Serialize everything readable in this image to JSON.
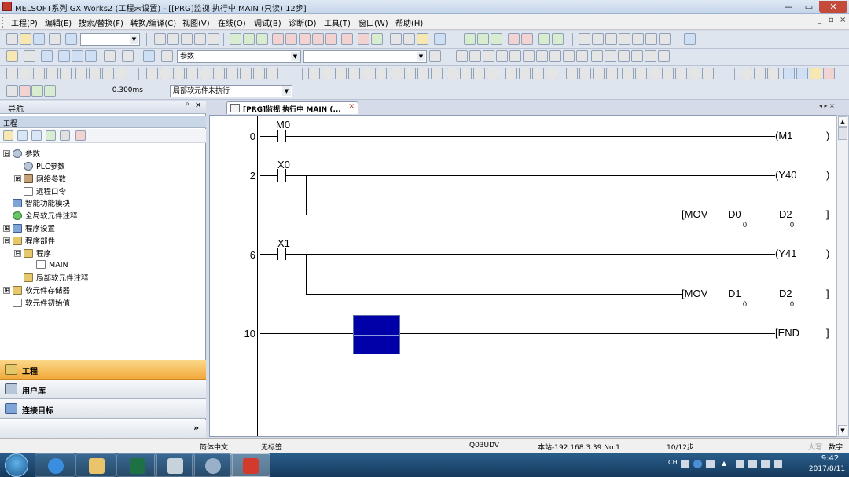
{
  "window": {
    "title": "MELSOFT系列 GX Works2 (工程未设置) - [[PRG]监视 执行中 MAIN (只读) 12步]",
    "min_glyph": "—",
    "max_glyph": "▭",
    "close_glyph": "✕"
  },
  "menu": {
    "items": [
      "工程(P)",
      "编辑(E)",
      "搜索/替换(F)",
      "转换/编译(C)",
      "视图(V)",
      "在线(O)",
      "调试(B)",
      "诊断(D)",
      "工具(T)",
      "窗口(W)",
      "帮助(H)"
    ],
    "child_min": "_",
    "child_restore": "▫",
    "child_close": "×"
  },
  "toolbar": {
    "device_combo": "参数",
    "monitor_interval": "0.300ms",
    "local_device_status": "局部软元件未执行"
  },
  "nav": {
    "title": "导航",
    "pin": "ᵖ",
    "close": "✕",
    "section_header": "工程",
    "tree": [
      {
        "label": "参数",
        "level": 0,
        "expander": "⊟",
        "icon": "gear"
      },
      {
        "label": "PLC参数",
        "level": 1,
        "expander": "",
        "icon": "gear"
      },
      {
        "label": "网络参数",
        "level": 1,
        "expander": "⊞",
        "icon": "net"
      },
      {
        "label": "远程口令",
        "level": 1,
        "expander": "",
        "icon": "doc"
      },
      {
        "label": "智能功能模块",
        "level": 0,
        "expander": "",
        "icon": "blue"
      },
      {
        "label": "全局软元件注释",
        "level": 0,
        "expander": "",
        "icon": "green"
      },
      {
        "label": "程序设置",
        "level": 0,
        "expander": "⊞",
        "icon": "blue"
      },
      {
        "label": "程序部件",
        "level": 0,
        "expander": "⊟",
        "icon": "folder"
      },
      {
        "label": "程序",
        "level": 1,
        "expander": "⊟",
        "icon": "folder"
      },
      {
        "label": "MAIN",
        "level": 2,
        "expander": "",
        "icon": "doc"
      },
      {
        "label": "局部软元件注释",
        "level": 1,
        "expander": "",
        "icon": "folder"
      },
      {
        "label": "软元件存储器",
        "level": 0,
        "expander": "⊞",
        "icon": "folder"
      },
      {
        "label": "软元件初始值",
        "level": 0,
        "expander": "",
        "icon": "doc"
      }
    ],
    "sections": [
      {
        "label": "工程",
        "active": true
      },
      {
        "label": "用户库",
        "active": false
      },
      {
        "label": "连接目标",
        "active": false
      }
    ],
    "more": "»"
  },
  "tab": {
    "label": "[PRG]监视 执行中 MAIN (...",
    "close": "×",
    "arrows": "◂ ▸ ×"
  },
  "ladder": {
    "rungs": [
      {
        "step": "0",
        "contact": "M0",
        "coil": "M1"
      },
      {
        "step": "2",
        "contact": "X0",
        "coil": "Y40",
        "mov": {
          "op": "MOV",
          "src": "D0",
          "dst": "D2",
          "src_val": "0",
          "dst_val": "0"
        }
      },
      {
        "step": "6",
        "contact": "X1",
        "coil": "Y41",
        "mov": {
          "op": "MOV",
          "src": "D1",
          "dst": "D2",
          "src_val": "0",
          "dst_val": "0"
        }
      },
      {
        "step": "10",
        "coil": "END"
      }
    ]
  },
  "status": {
    "language": "简体中文",
    "label": "无标签",
    "cpu": "Q03UDV",
    "connection": "本站-192.168.3.39 No.1",
    "steps": "10/12步",
    "caps": "大写",
    "num": "数字"
  },
  "taskbar": {
    "ime": "CH",
    "time": "9:42",
    "date": "2017/8/11"
  }
}
